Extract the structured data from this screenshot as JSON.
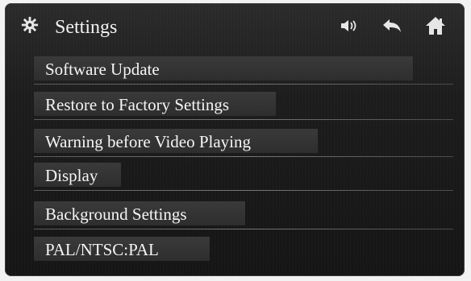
{
  "header": {
    "title": "Settings",
    "icons": [
      "gear-icon",
      "speaker-icon",
      "back-icon",
      "home-icon"
    ]
  },
  "menu": {
    "items": [
      {
        "label": "Software Update"
      },
      {
        "label": "Restore to Factory Settings"
      },
      {
        "label": "Warning before Video Playing"
      },
      {
        "label": "Display"
      },
      {
        "label": "Background Settings"
      },
      {
        "label": "PAL/NTSC:PAL"
      }
    ]
  },
  "colors": {
    "text": "#f5f5f5",
    "panel": "#1c1c1c",
    "item_bg": "#3a3a3a",
    "divider": "#6a6a6a"
  }
}
